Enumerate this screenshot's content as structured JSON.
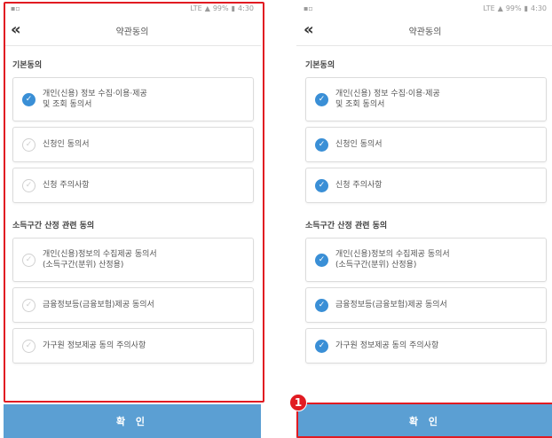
{
  "status_bar": {
    "signal": "LTE",
    "battery": "99%",
    "time": "4:30"
  },
  "header": {
    "back_icon": "«",
    "title": "약관동의"
  },
  "sections": {
    "basic": "기본동의",
    "income": "소득구간 산정 관련 동의"
  },
  "items": [
    {
      "label": "개인(신용) 정보 수집·이용·제공\n및 조회 동의서"
    },
    {
      "label": "신청인 동의서"
    },
    {
      "label": "신청 주의사항"
    },
    {
      "label": "개인(신용)정보의 수집제공 동의서\n(소득구간(분위) 산정용)"
    },
    {
      "label": "금융정보등(금융보험)제공 동의서"
    },
    {
      "label": "가구원 정보제공 동의 주의사항"
    }
  ],
  "left_checked": [
    true,
    false,
    false,
    false,
    false,
    false
  ],
  "right_checked": [
    true,
    true,
    true,
    true,
    true,
    true
  ],
  "confirm_label": "확 인",
  "step_number": "1",
  "colors": {
    "accent": "#3a8fd6",
    "button": "#5b9fd3",
    "highlight": "#e11b22"
  }
}
